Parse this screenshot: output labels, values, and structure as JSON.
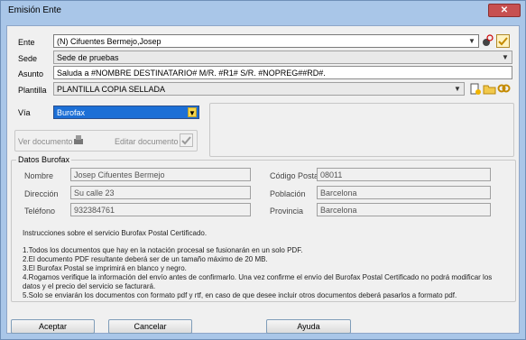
{
  "window": {
    "title": "Emisión Ente",
    "close_icon": "close-icon"
  },
  "form": {
    "ente_label": "Ente",
    "ente_value": "(N) Cifuentes Bermejo,Josep",
    "sede_label": "Sede",
    "sede_value": "Sede de pruebas",
    "asunto_label": "Asunto",
    "asunto_value": "Saluda a #NOMBRE DESTINATARIO# M/R. #R1# S/R. #NOPREG##RD#.",
    "plantilla_label": "Plantilla",
    "plantilla_value": "PLANTILLA COPIA SELLADA",
    "via_label": "Vía",
    "via_value": "Burofax",
    "ver_documento": "Ver documento",
    "editar_documento": "Editar documento"
  },
  "burofax": {
    "legend": "Datos Burofax",
    "nombre_label": "Nombre",
    "nombre_value": "Josep Cifuentes Bermejo",
    "direccion_label": "Dirección",
    "direccion_value": "Su calle 23",
    "telefono_label": "Teléfono",
    "telefono_value": "932384761",
    "cp_label": "Código Postal",
    "cp_value": "08011",
    "poblacion_label": "Población",
    "poblacion_value": "Barcelona",
    "provincia_label": "Provincia",
    "provincia_value": "Barcelona"
  },
  "instructions": {
    "heading": "Instrucciones sobre el servicio Burofax Postal Certificado.",
    "l1": "1.Todos los documentos que hay en la notación procesal se fusionarán en un solo PDF.",
    "l2": "2.El documento PDF resultante deberá ser de un tamaño máximo de 20 MB.",
    "l3": "3.El Burofax Postal se imprimirá en blanco y negro.",
    "l4": "4.Rogamos verifique la información del envío antes de confirmarlo. Una vez confirme el envío del Burofax Postal Certificado no podrá modificar los",
    "l4b": "datos y el precio del servicio se facturará.",
    "l5": "5.Solo se enviarán los documentos con formato pdf y rtf, en caso de que desee incluir otros documentos deberá pasarlos a formato pdf."
  },
  "buttons": {
    "aceptar": "Aceptar",
    "cancelar": "Cancelar",
    "ayuda": "Ayuda"
  },
  "colors": {
    "via_selected": "#1c6fd6",
    "title_bar": "#a9c6e8"
  }
}
